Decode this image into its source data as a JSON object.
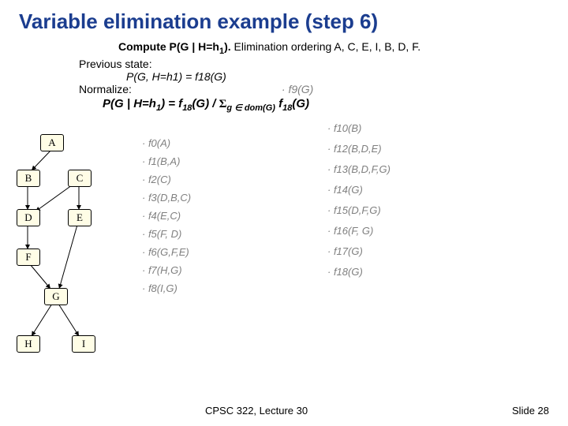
{
  "title": "Variable elimination example (step 6)",
  "compute_label": "Compute P(G | H=h",
  "compute_sub": "1",
  "compute_tail": ").",
  "elim_text": " Elimination ordering A, C, E, I, B, D, F.",
  "prev_label": "Previous state:",
  "prev_formula": "P(G, H=h1) = f18(G)",
  "normalize_label": "Normalize:",
  "f9_label": "· f9(G)",
  "formula": "P(G | H=h1) = f18(G) / Σg ∈ dom(G) f18(G)",
  "left_factors": [
    "· f0(A)",
    "· f1(B,A)",
    "· f2(C)",
    "· f3(D,B,C)",
    "· f4(E,C)",
    "· f5(F, D)",
    "· f6(G,F,E)",
    "· f7(H,G)",
    "· f8(I,G)"
  ],
  "right_factors": [
    "· f10(B)",
    "· f12(B,D,E)",
    "· f13(B,D,F,G)",
    "· f14(G)",
    "· f15(D,F,G)",
    "· f16(F, G)",
    "· f17(G)",
    "· f18(G)"
  ],
  "nodes": {
    "A": "A",
    "B": "B",
    "C": "C",
    "D": "D",
    "E": "E",
    "F": "F",
    "G": "G",
    "H": "H",
    "I": "I"
  },
  "footer_left": "CPSC 322, Lecture 30",
  "footer_right": "Slide 28"
}
